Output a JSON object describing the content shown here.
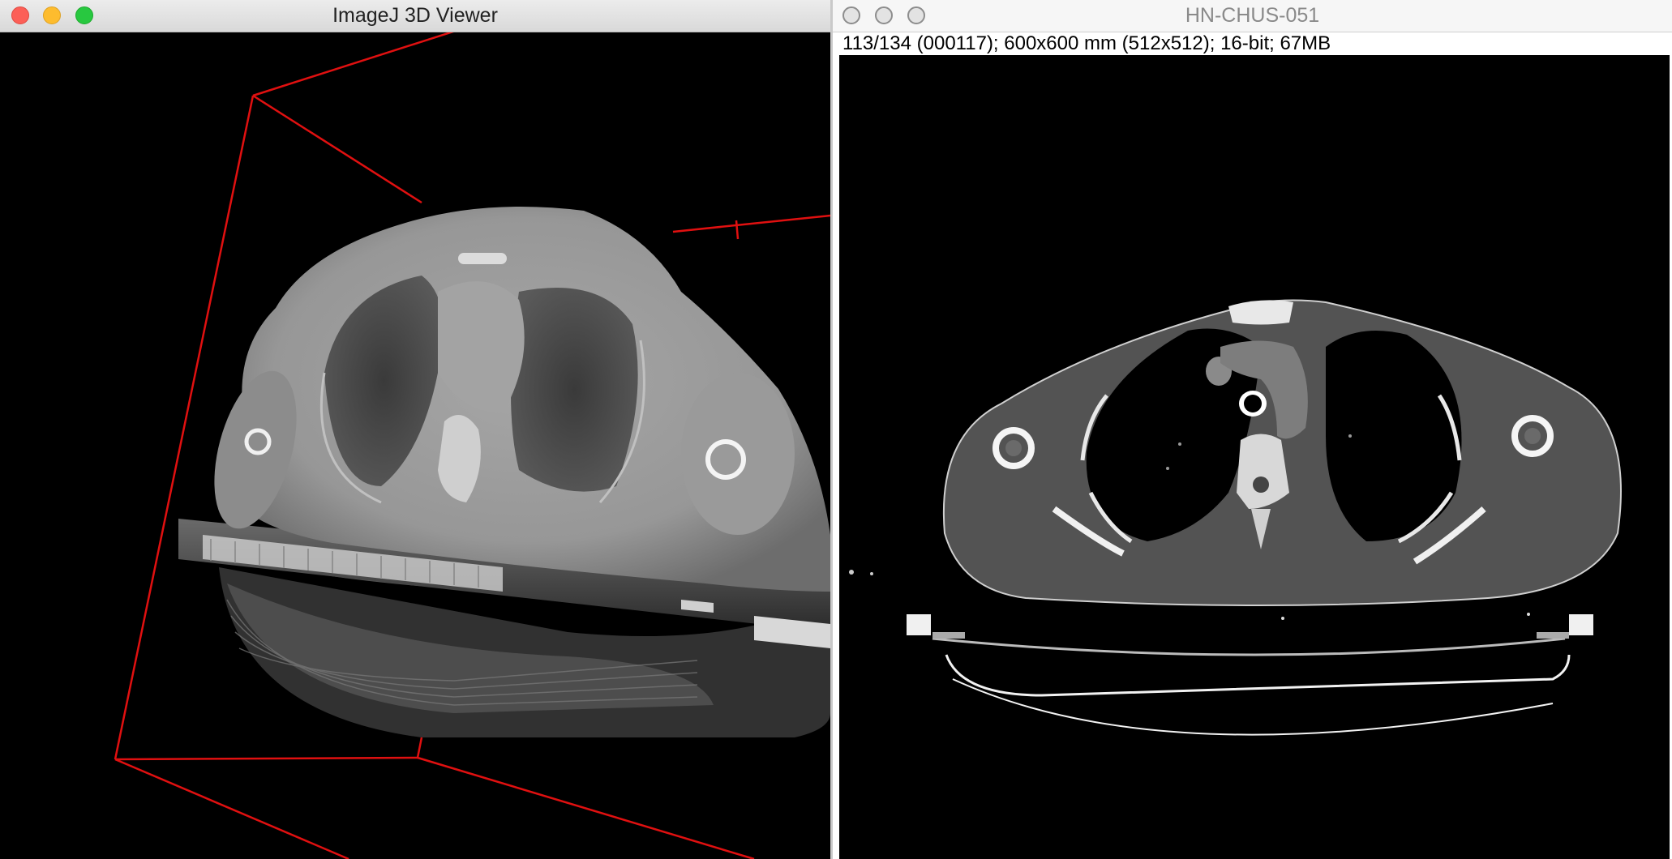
{
  "left_window": {
    "title": "ImageJ 3D Viewer",
    "controls": {
      "close": "close-icon",
      "minimize": "minimize-icon",
      "zoom": "zoom-icon"
    },
    "bounding_box_color": "#e01010"
  },
  "right_window": {
    "title": "HN-CHUS-051",
    "info_bar": "113/134 (000117); 600x600 mm (512x512); 16-bit; 67MB",
    "controls": {
      "close": "close-icon",
      "minimize": "minimize-icon",
      "zoom": "zoom-icon"
    }
  },
  "colors": {
    "window_chrome": "#e0e0e0",
    "background": "#000000"
  }
}
